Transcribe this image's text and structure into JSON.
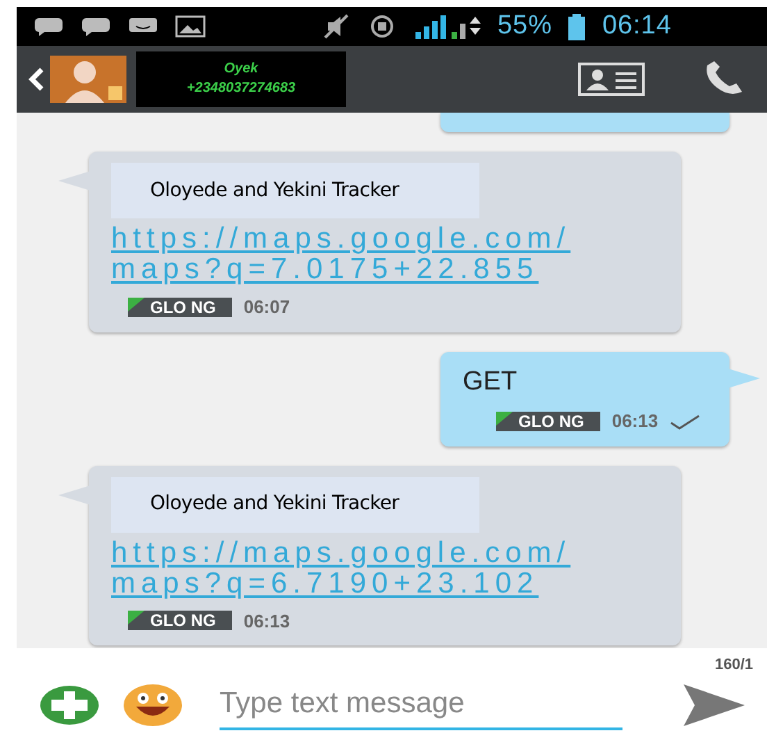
{
  "status_bar": {
    "battery": "55%",
    "time": "06:14"
  },
  "header": {
    "contact_name": "Oyek",
    "contact_number": "+2348037274683"
  },
  "messages": [
    {
      "kind": "received",
      "title": "Oloyede and Yekini Tracker",
      "link": [
        "https://maps.google.com/",
        "maps?q=7.0175+22.855"
      ],
      "carrier": "GLO NG",
      "time": "06:07"
    },
    {
      "kind": "sent",
      "text": "GET",
      "carrier": "GLO NG",
      "time": "06:13",
      "delivered": true
    },
    {
      "kind": "received",
      "title": "Oloyede and Yekini Tracker",
      "link": [
        "https://maps.google.com/",
        "maps?q=6.7190+23.102"
      ],
      "carrier": "GLO NG",
      "time": "06:13"
    }
  ],
  "composer": {
    "counter": "160/1",
    "placeholder": "Type text message"
  }
}
